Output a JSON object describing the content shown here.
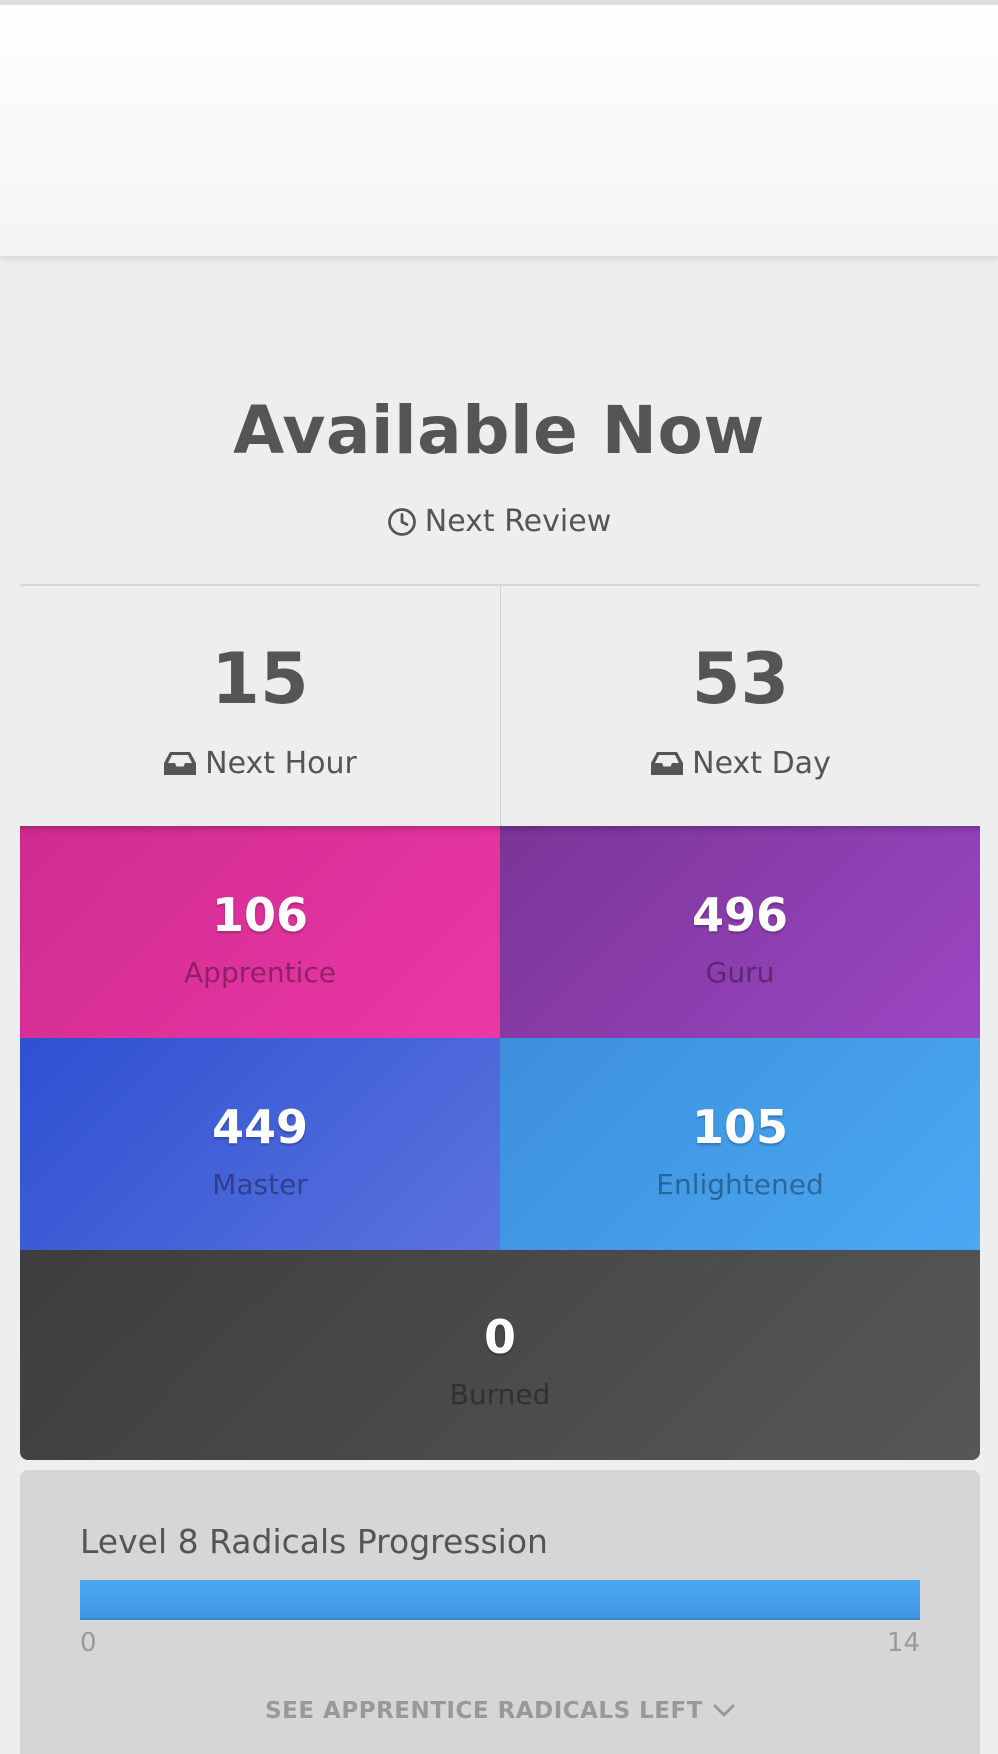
{
  "header": {
    "title": "Available Now",
    "next_review_label": "Next Review"
  },
  "forecast": [
    {
      "count": "15",
      "label": "Next Hour"
    },
    {
      "count": "53",
      "label": "Next Day"
    }
  ],
  "srs": {
    "apprentice": {
      "count": "106",
      "label": "Apprentice",
      "color": "#dd33a0"
    },
    "guru": {
      "count": "496",
      "label": "Guru",
      "color": "#8b3daf"
    },
    "master": {
      "count": "449",
      "label": "Master",
      "color": "#4462d8"
    },
    "enlightened": {
      "count": "105",
      "label": "Enlightened",
      "color": "#449ee8"
    },
    "burned": {
      "count": "0",
      "label": "Burned",
      "color": "#4a4a4a"
    }
  },
  "progression": {
    "title": "Level 8 Radicals Progression",
    "min": "0",
    "max": "14",
    "fraction": 1.0,
    "toggle_label": "SEE APPRENTICE RADICALS LEFT"
  },
  "icons": {
    "clock": "clock-icon",
    "inbox": "inbox-icon",
    "chevron": "chevron-down-icon"
  }
}
